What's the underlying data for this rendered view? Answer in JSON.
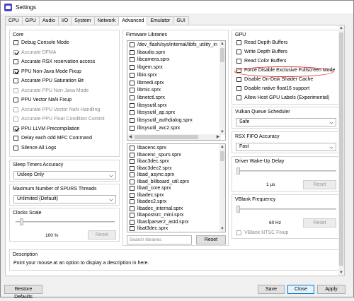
{
  "window": {
    "title": "Settings"
  },
  "tabs": [
    "CPU",
    "GPU",
    "Audio",
    "I/O",
    "System",
    "Network",
    "Advanced",
    "Emulator",
    "GUI"
  ],
  "active_tab": "Advanced",
  "core": {
    "title": "Core",
    "items": [
      {
        "label": "Debug Console Mode",
        "checked": false,
        "enabled": true
      },
      {
        "label": "Accurate DFMA",
        "checked": true,
        "enabled": false
      },
      {
        "label": "Accurate RSX reservation access",
        "checked": false,
        "enabled": true
      },
      {
        "label": "PPU Non-Java Mode Fixup",
        "checked": true,
        "enabled": true
      },
      {
        "label": "Accurate PPU Saturation Bit",
        "checked": false,
        "enabled": true
      },
      {
        "label": "Accurate PPU Non-Java Mode",
        "checked": false,
        "enabled": false
      },
      {
        "label": "PPU Vector NaN Fixup",
        "checked": false,
        "enabled": true
      },
      {
        "label": "Accurate PPU Vector NaN Handling",
        "checked": false,
        "enabled": false
      },
      {
        "label": "Accurate PPU Float Condition Control",
        "checked": false,
        "enabled": false
      },
      {
        "label": "PPU LLVM Precompilation",
        "checked": true,
        "enabled": true
      },
      {
        "label": "Delay each odd MFC Command",
        "checked": false,
        "enabled": true
      },
      {
        "label": "Silence All Logs",
        "checked": false,
        "enabled": true
      }
    ]
  },
  "sleep_timers": {
    "title": "Sleep Timers Accuracy",
    "value": "Usleep Only"
  },
  "spurs_threads": {
    "title": "Maximum Number of SPURS Threads",
    "value": "Unlimited (Default)"
  },
  "clocks_scale": {
    "title": "Clocks Scale",
    "value_text": "100 %",
    "level_fraction": 0.0,
    "reset_label": "Reset"
  },
  "firmware": {
    "title": "Firmware Libraries",
    "top_list": [
      "/dev_flash/sys/internal/libfs_utility_in",
      "libaudio.sprx",
      "libcamera.sprx",
      "libgem.sprx",
      "libio.sprx",
      "libmedi.sprx",
      "libmic.sprx",
      "libnetctl.sprx",
      "libsysutil.sprx",
      "libsysutil_ap.sprx",
      "libsysutil_authdialog.sprx",
      "libsysutil_avc2.sprx"
    ],
    "bottom_list": [
      "libacenc.sprx",
      "libacenc_spurs.sprx",
      "libac3dec.sprx",
      "libac3dec2.sprx",
      "libad_async.sprx",
      "libad_billboard_util.sprx",
      "libad_core.sprx",
      "libadec.sprx",
      "libadec2.sprx",
      "libadec_internal.sprx",
      "libapostsrc_mini.sprx",
      "libasfparser2_astd.sprx",
      "libat3dec.sprx"
    ],
    "search_placeholder": "Search libraries",
    "reset_label": "Reset"
  },
  "gpu": {
    "title": "GPU",
    "items": [
      {
        "label": "Read Depth Buffers",
        "checked": false,
        "enabled": true
      },
      {
        "label": "Write Depth Buffers",
        "checked": false,
        "enabled": true
      },
      {
        "label": "Read Color Buffers",
        "checked": false,
        "enabled": true
      },
      {
        "label": "Force Disable Exclusive Fullscreen Mode",
        "checked": false,
        "enabled": true
      },
      {
        "label": "Disable On-Disk Shader Cache",
        "checked": false,
        "enabled": true
      },
      {
        "label": "Disable native float16 support",
        "checked": false,
        "enabled": true
      },
      {
        "label": "Allow Host GPU Labels (Experimental)",
        "checked": false,
        "enabled": true
      }
    ]
  },
  "vulkan_queue": {
    "title": "Vulkan Queue Scheduler",
    "value": "Safe"
  },
  "rsx_fifo": {
    "title": "RSX FIFO Accuracy",
    "value": "Fast"
  },
  "driver_wakeup": {
    "title": "Driver Wake-Up Delay",
    "value_text": "1 µs",
    "level_fraction": 0.0,
    "reset_label": "Reset"
  },
  "vblank": {
    "title": "VBlank Frequency",
    "value_text": "60 Hz",
    "level_fraction": 0.0,
    "reset_label": "Reset",
    "ntsc_label": "VBlank NTSC Fixup",
    "ntsc_checked": false
  },
  "description": {
    "title": "Description",
    "text": "Point your mouse at an option to display a description in here."
  },
  "footer": {
    "restore": "Restore Defaults",
    "save": "Save",
    "close": "Close",
    "apply": "Apply"
  },
  "colors": {
    "highlight_circle": "#e8322c",
    "focus_border": "#0078d7"
  }
}
